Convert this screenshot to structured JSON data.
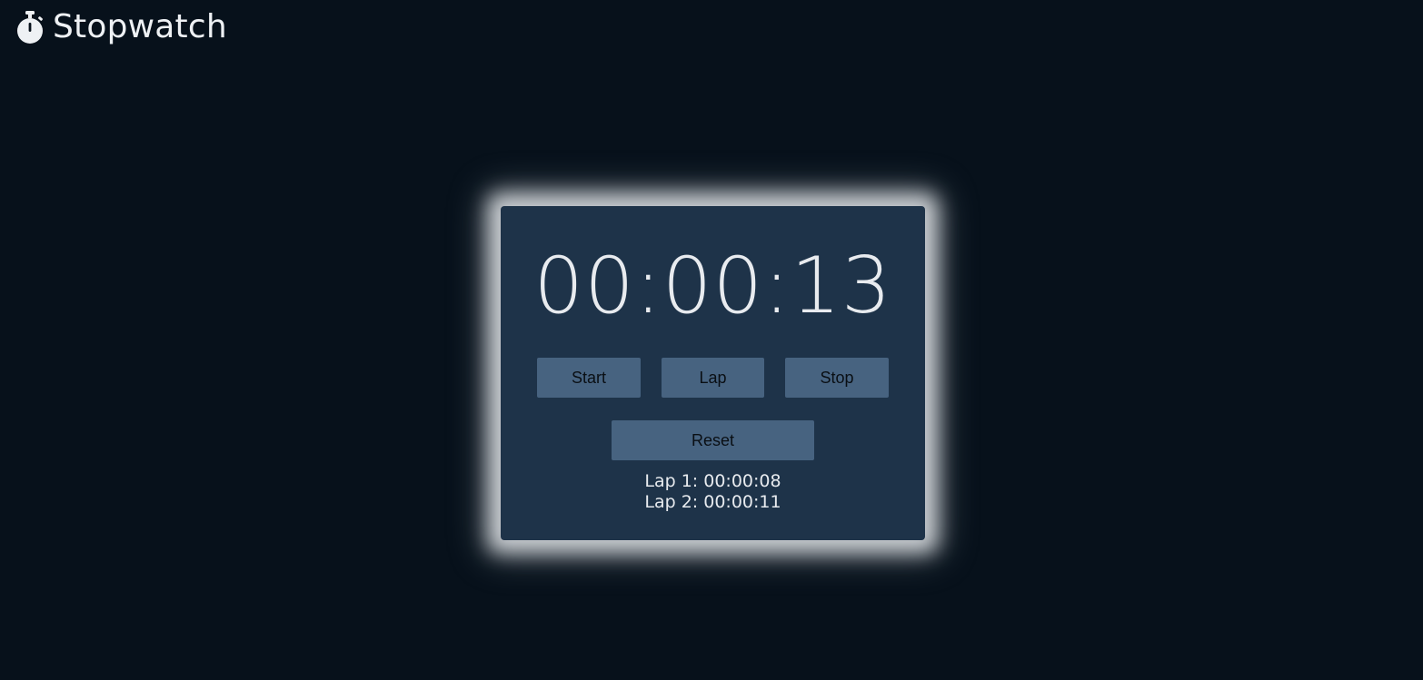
{
  "header": {
    "title": "Stopwatch",
    "icon": "stopwatch-icon"
  },
  "stopwatch": {
    "time": "00:00:13",
    "buttons": {
      "start": "Start",
      "lap": "Lap",
      "stop": "Stop",
      "reset": "Reset"
    },
    "laps": [
      "Lap 1: 00:00:08",
      "Lap 2: 00:00:11"
    ]
  },
  "colors": {
    "background": "#07111b",
    "card": "#1e3349",
    "button": "#476380",
    "text": "#e8ebef",
    "glow": "#e1e4e8"
  }
}
